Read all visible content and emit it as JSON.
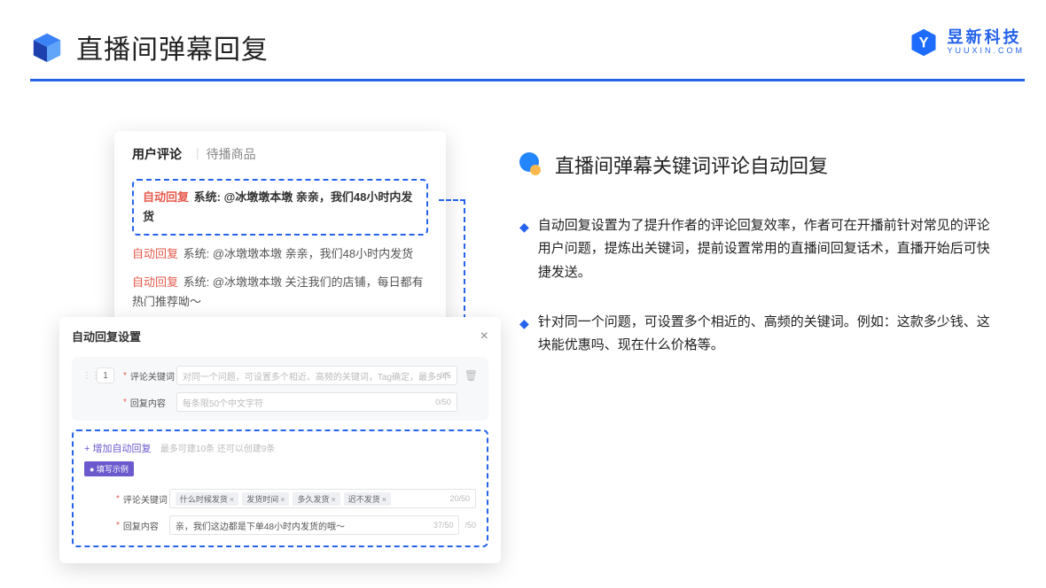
{
  "header": {
    "title": "直播间弹幕回复",
    "brand_cn": "昱新科技",
    "brand_en": "YUUXIN.COM"
  },
  "section": {
    "title": "直播间弹幕关键词评论自动回复",
    "bullets": [
      "自动回复设置为了提升作者的评论回复效率，作者可在开播前针对常见的评论用户问题，提炼出关键词，提前设置常用的直播间回复话术，直播开始后可快捷发送。",
      "针对同一个问题，可设置多个相近的、高频的关键词。例如：这款多少钱、这块能优惠吗、现在什么价格等。"
    ]
  },
  "comments": {
    "tabs": {
      "active": "用户评论",
      "inactive": "待播商品"
    },
    "auto_reply_label": "自动回复",
    "items": [
      "系统: @冰墩墩本墩 亲亲，我们48小时内发货",
      "系统: @冰墩墩本墩 亲亲，我们48小时内发货",
      "系统: @冰墩墩本墩 关注我们的店铺，每日都有热门推荐呦～"
    ]
  },
  "settings": {
    "title": "自动回复设置",
    "row_num": "1",
    "labels": {
      "keyword": "评论关键词",
      "content": "回复内容"
    },
    "placeholders": {
      "keyword": "对同一个问题，可设置多个相近、高频的关键词，Tag确定，最多5个",
      "content": "每条限50个中文字符"
    },
    "counts": {
      "keyword": "0/5",
      "content": "0/50"
    },
    "add_link": "+ 增加自动回复",
    "add_hint": "最多可建10条 还可以创建9条",
    "example_badge": "● 填写示例",
    "ex_tags": [
      "什么时候发货",
      "发货时间",
      "多久发货",
      "迟不发货"
    ],
    "ex_kw_count": "20/50",
    "ex_content": "亲，我们这边都是下单48小时内发货的哦～",
    "ex_content_count": "37/50",
    "ex_trail_count": "/50"
  }
}
